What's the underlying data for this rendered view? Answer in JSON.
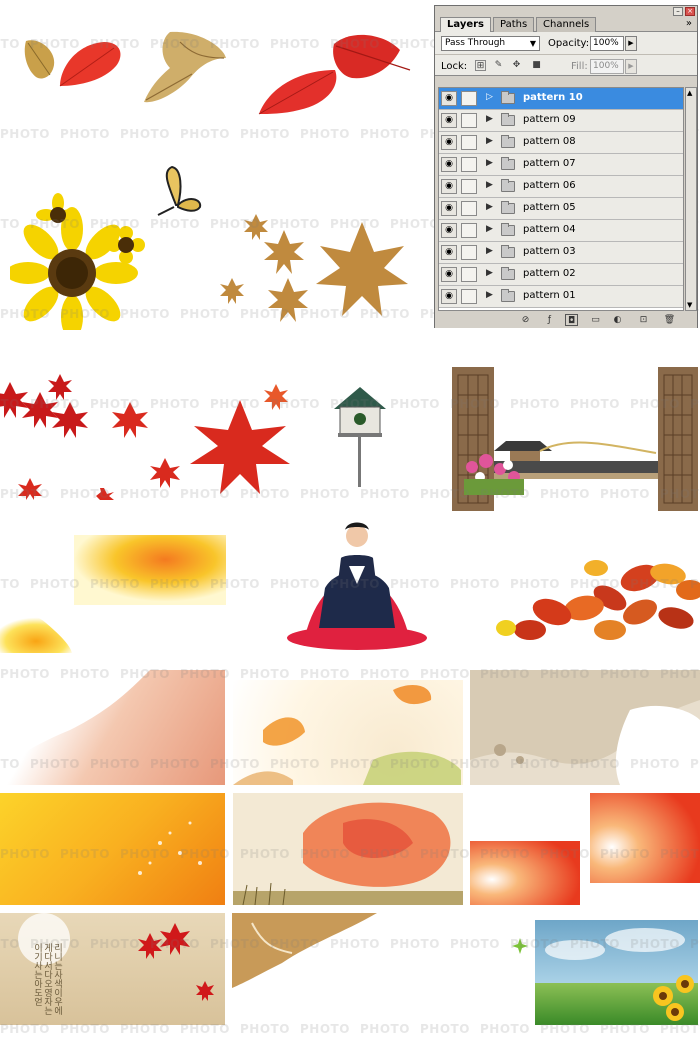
{
  "watermark": {
    "text": "PHOTO"
  },
  "layers_panel": {
    "tabs": [
      {
        "label": "Layers"
      },
      {
        "label": "Paths"
      },
      {
        "label": "Channels"
      }
    ],
    "blend_mode": "Pass Through",
    "opacity_label": "Opacity:",
    "opacity_value": "100%",
    "lock_label": "Lock:",
    "fill_label": "Fill:",
    "fill_value": "100%",
    "layers": [
      {
        "name": "pattern 10",
        "selected": true
      },
      {
        "name": "pattern 09"
      },
      {
        "name": "pattern 08"
      },
      {
        "name": "pattern 07"
      },
      {
        "name": "pattern 06"
      },
      {
        "name": "pattern 05"
      },
      {
        "name": "pattern 04"
      },
      {
        "name": "pattern 03"
      },
      {
        "name": "pattern 02"
      },
      {
        "name": "pattern 01"
      }
    ]
  },
  "korean_text": "리니는사색이우에게다서다오영자는이기사는아도얻"
}
